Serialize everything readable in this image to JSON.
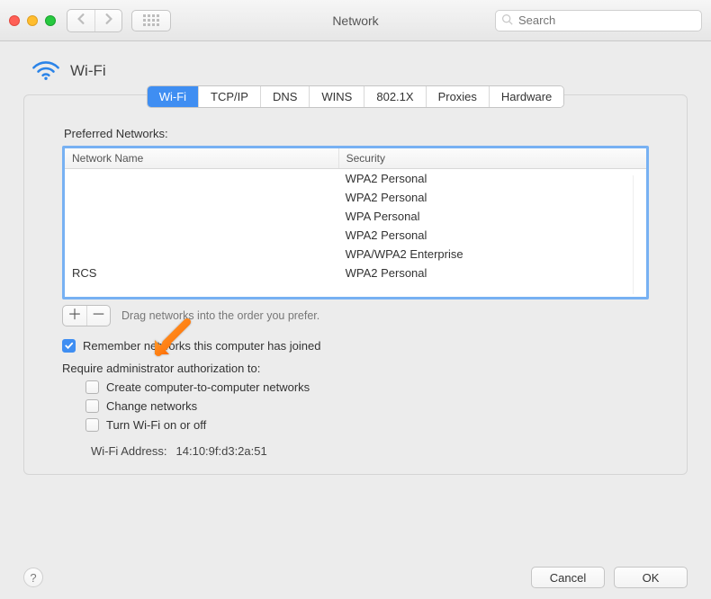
{
  "window": {
    "title": "Network",
    "search_placeholder": "Search"
  },
  "header": {
    "title": "Wi-Fi"
  },
  "tabs": [
    {
      "id": "wifi",
      "label": "Wi-Fi",
      "active": true
    },
    {
      "id": "tcpip",
      "label": "TCP/IP"
    },
    {
      "id": "dns",
      "label": "DNS"
    },
    {
      "id": "wins",
      "label": "WINS"
    },
    {
      "id": "8021x",
      "label": "802.1X"
    },
    {
      "id": "proxies",
      "label": "Proxies"
    },
    {
      "id": "hardware",
      "label": "Hardware"
    }
  ],
  "preferred": {
    "label": "Preferred Networks:",
    "columns": {
      "name": "Network Name",
      "security": "Security"
    },
    "rows": [
      {
        "name": "",
        "security": "WPA2 Personal"
      },
      {
        "name": "",
        "security": "WPA2 Personal"
      },
      {
        "name": "",
        "security": "WPA Personal"
      },
      {
        "name": "",
        "security": "WPA2 Personal"
      },
      {
        "name": "",
        "security": "WPA/WPA2 Enterprise"
      },
      {
        "name": "RCS",
        "security": "WPA2 Personal"
      }
    ],
    "add_glyph": "＋",
    "remove_glyph": "－",
    "hint": "Drag networks into the order you prefer."
  },
  "options": {
    "remember": {
      "checked": true,
      "label": "Remember networks this computer has joined"
    },
    "auth_heading": "Require administrator authorization to:",
    "auth": [
      {
        "id": "create-net",
        "checked": false,
        "label": "Create computer-to-computer networks"
      },
      {
        "id": "change-net",
        "checked": false,
        "label": "Change networks"
      },
      {
        "id": "toggle-wifi",
        "checked": false,
        "label": "Turn Wi-Fi on or off"
      }
    ]
  },
  "wifi_address": {
    "label": "Wi-Fi Address:",
    "value": "14:10:9f:d3:2a:51"
  },
  "footer": {
    "help": "?",
    "cancel": "Cancel",
    "ok": "OK"
  }
}
